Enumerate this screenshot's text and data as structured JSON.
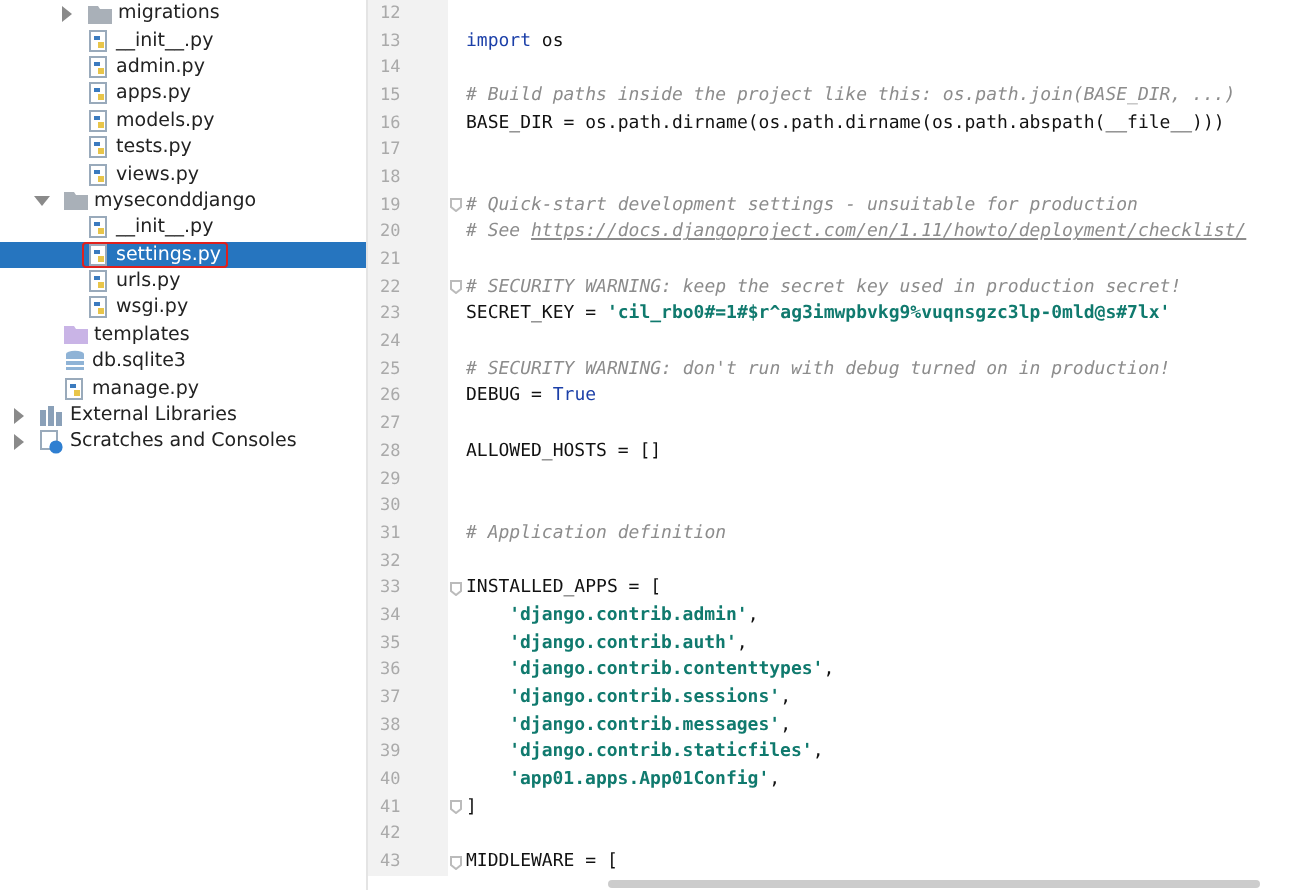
{
  "project_tree": [
    {
      "children": [
        {
          "children": [
            {
              "label": "migrations",
              "kind": "folder",
              "expanded": false,
              "selected": false,
              "marked": false
            },
            {
              "label": "__init__.py",
              "kind": "python",
              "selected": false,
              "marked": false
            },
            {
              "label": "admin.py",
              "kind": "python",
              "selected": false,
              "marked": false
            },
            {
              "label": "apps.py",
              "kind": "python",
              "selected": false,
              "marked": false
            },
            {
              "label": "models.py",
              "kind": "python",
              "selected": false,
              "marked": false
            },
            {
              "label": "tests.py",
              "kind": "python",
              "selected": false,
              "marked": false
            },
            {
              "label": "views.py",
              "kind": "python",
              "selected": false,
              "marked": false
            }
          ]
        },
        {
          "label": "myseconddjango",
          "kind": "folder",
          "expanded": true,
          "selected": false,
          "marked": false,
          "children": [
            {
              "label": "__init__.py",
              "kind": "python",
              "selected": false,
              "marked": false
            },
            {
              "label": "settings.py",
              "kind": "python",
              "selected": true,
              "marked": true
            },
            {
              "label": "urls.py",
              "kind": "python",
              "selected": false,
              "marked": false
            },
            {
              "label": "wsgi.py",
              "kind": "python",
              "selected": false,
              "marked": false
            }
          ]
        },
        {
          "label": "templates",
          "kind": "template-folder",
          "selected": false,
          "marked": false
        },
        {
          "label": "db.sqlite3",
          "kind": "database",
          "selected": false,
          "marked": false
        },
        {
          "label": "manage.py",
          "kind": "python",
          "selected": false,
          "marked": false
        }
      ]
    },
    {
      "label": "External Libraries",
      "kind": "library",
      "expanded": false,
      "selected": false,
      "marked": false
    },
    {
      "label": "Scratches and Consoles",
      "kind": "scratches",
      "expanded": false,
      "selected": false,
      "marked": false
    }
  ],
  "editor_lines": [
    {
      "number": "12",
      "fold": false
    },
    {
      "number": "13",
      "fold": false,
      "tokens": [
        {
          "kind": "keyword",
          "text": "import"
        },
        {
          "kind": "plain",
          "text": " os"
        }
      ]
    },
    {
      "number": "14",
      "fold": false
    },
    {
      "number": "15",
      "fold": false,
      "tokens": [
        {
          "kind": "comment",
          "text": "# Build paths inside the project like this: os.path.join(BASE_DIR, ...)"
        }
      ]
    },
    {
      "number": "16",
      "fold": false,
      "tokens": [
        {
          "kind": "plain",
          "text": "BASE_DIR = os.path.dirname(os.path.dirname(os.path.abspath(__file__)))"
        }
      ]
    },
    {
      "number": "17",
      "fold": false
    },
    {
      "number": "18",
      "fold": false
    },
    {
      "number": "19",
      "fold": true,
      "tokens": [
        {
          "kind": "comment",
          "text": "# Quick-start development settings - unsuitable for production"
        }
      ]
    },
    {
      "number": "20",
      "fold": false,
      "tokens": [
        {
          "kind": "comment",
          "text": "# See "
        },
        {
          "kind": "link",
          "text": "https://docs.djangoproject.com/en/1.11/howto/deployment/checklist/"
        }
      ]
    },
    {
      "number": "21",
      "fold": false
    },
    {
      "number": "22",
      "fold": true,
      "tokens": [
        {
          "kind": "comment",
          "text": "# SECURITY WARNING: keep the secret key used in production secret!"
        }
      ]
    },
    {
      "number": "23",
      "fold": false,
      "tokens": [
        {
          "kind": "plain",
          "text": "SECRET_KEY = "
        },
        {
          "kind": "string",
          "text": "'cil_rbo0#=1#$r^ag3imwpbvkg9%vuqnsgzc3lp-0mld@s#7lx'"
        }
      ]
    },
    {
      "number": "24",
      "fold": false
    },
    {
      "number": "25",
      "fold": false,
      "tokens": [
        {
          "kind": "comment",
          "text": "# SECURITY WARNING: don't run with debug turned on in production!"
        }
      ]
    },
    {
      "number": "26",
      "fold": false,
      "tokens": [
        {
          "kind": "plain",
          "text": "DEBUG = "
        },
        {
          "kind": "keyword",
          "text": "True"
        }
      ]
    },
    {
      "number": "27",
      "fold": false
    },
    {
      "number": "28",
      "fold": false,
      "tokens": [
        {
          "kind": "plain",
          "text": "ALLOWED_HOSTS = []"
        }
      ]
    },
    {
      "number": "29",
      "fold": false
    },
    {
      "number": "30",
      "fold": false
    },
    {
      "number": "31",
      "fold": false,
      "tokens": [
        {
          "kind": "comment",
          "text": "# Application definition"
        }
      ]
    },
    {
      "number": "32",
      "fold": false
    },
    {
      "number": "33",
      "fold": true,
      "tokens": [
        {
          "kind": "plain",
          "text": "INSTALLED_APPS = ["
        }
      ]
    },
    {
      "number": "34",
      "fold": false,
      "indented": true,
      "tokens": [
        {
          "kind": "string",
          "text": "'django.contrib.admin'"
        },
        {
          "kind": "plain",
          "text": ","
        }
      ]
    },
    {
      "number": "35",
      "fold": false,
      "indented": true,
      "tokens": [
        {
          "kind": "string",
          "text": "'django.contrib.auth'"
        },
        {
          "kind": "plain",
          "text": ","
        }
      ]
    },
    {
      "number": "36",
      "fold": false,
      "indented": true,
      "tokens": [
        {
          "kind": "string",
          "text": "'django.contrib.contenttypes'"
        },
        {
          "kind": "plain",
          "text": ","
        }
      ]
    },
    {
      "number": "37",
      "fold": false,
      "indented": true,
      "tokens": [
        {
          "kind": "string",
          "text": "'django.contrib.sessions'"
        },
        {
          "kind": "plain",
          "text": ","
        }
      ]
    },
    {
      "number": "38",
      "fold": false,
      "indented": true,
      "tokens": [
        {
          "kind": "string",
          "text": "'django.contrib.messages'"
        },
        {
          "kind": "plain",
          "text": ","
        }
      ]
    },
    {
      "number": "39",
      "fold": false,
      "indented": true,
      "tokens": [
        {
          "kind": "string",
          "text": "'django.contrib.staticfiles'"
        },
        {
          "kind": "plain",
          "text": ","
        }
      ]
    },
    {
      "number": "40",
      "fold": false,
      "indented": true,
      "tokens": [
        {
          "kind": "string",
          "text": "'app01.apps.App01Config'"
        },
        {
          "kind": "plain",
          "text": ","
        }
      ]
    },
    {
      "number": "41",
      "fold": true,
      "tokens": [
        {
          "kind": "plain",
          "text": "]"
        }
      ]
    },
    {
      "number": "42",
      "fold": false
    },
    {
      "number": "43",
      "fold": true,
      "tokens": [
        {
          "kind": "plain",
          "text": "MIDDLEWARE = ["
        }
      ]
    }
  ]
}
